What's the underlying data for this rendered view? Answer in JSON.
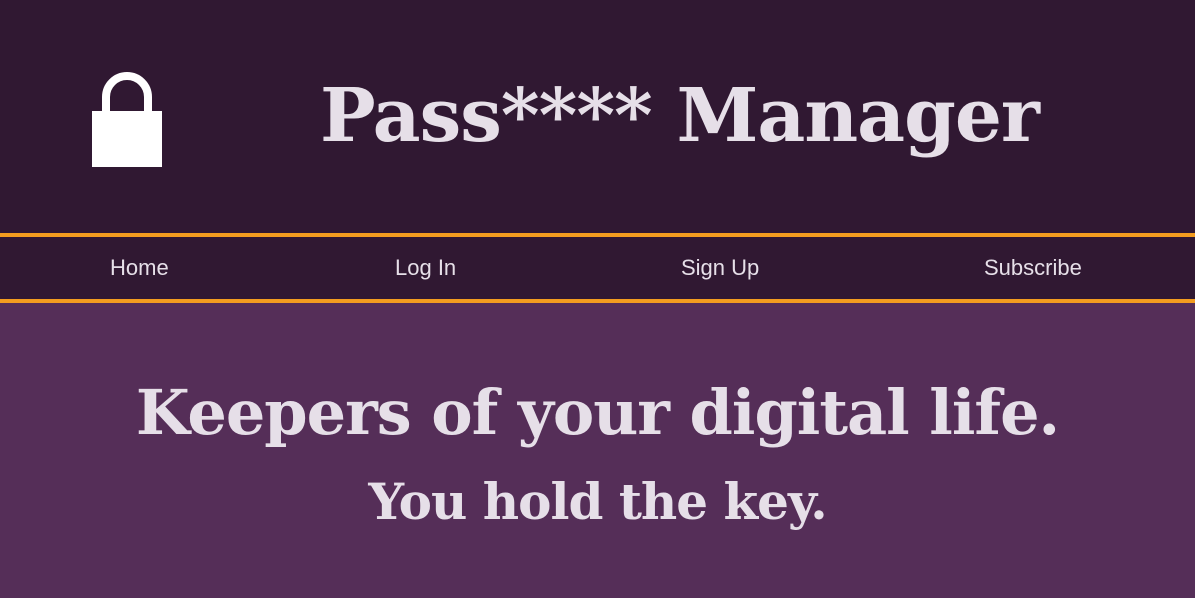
{
  "header": {
    "logo_icon": "lock-icon",
    "title": "Pass**** Manager"
  },
  "nav": {
    "items": [
      {
        "label": "Home"
      },
      {
        "label": "Log In"
      },
      {
        "label": "Sign Up"
      },
      {
        "label": "Subscribe"
      }
    ]
  },
  "hero": {
    "headline": "Keepers of your digital life.",
    "tagline": "You hold the key."
  },
  "colors": {
    "header_bg": "#301832",
    "hero_bg": "#552e58",
    "accent": "#f39c1f",
    "text": "#e6dfe8"
  }
}
